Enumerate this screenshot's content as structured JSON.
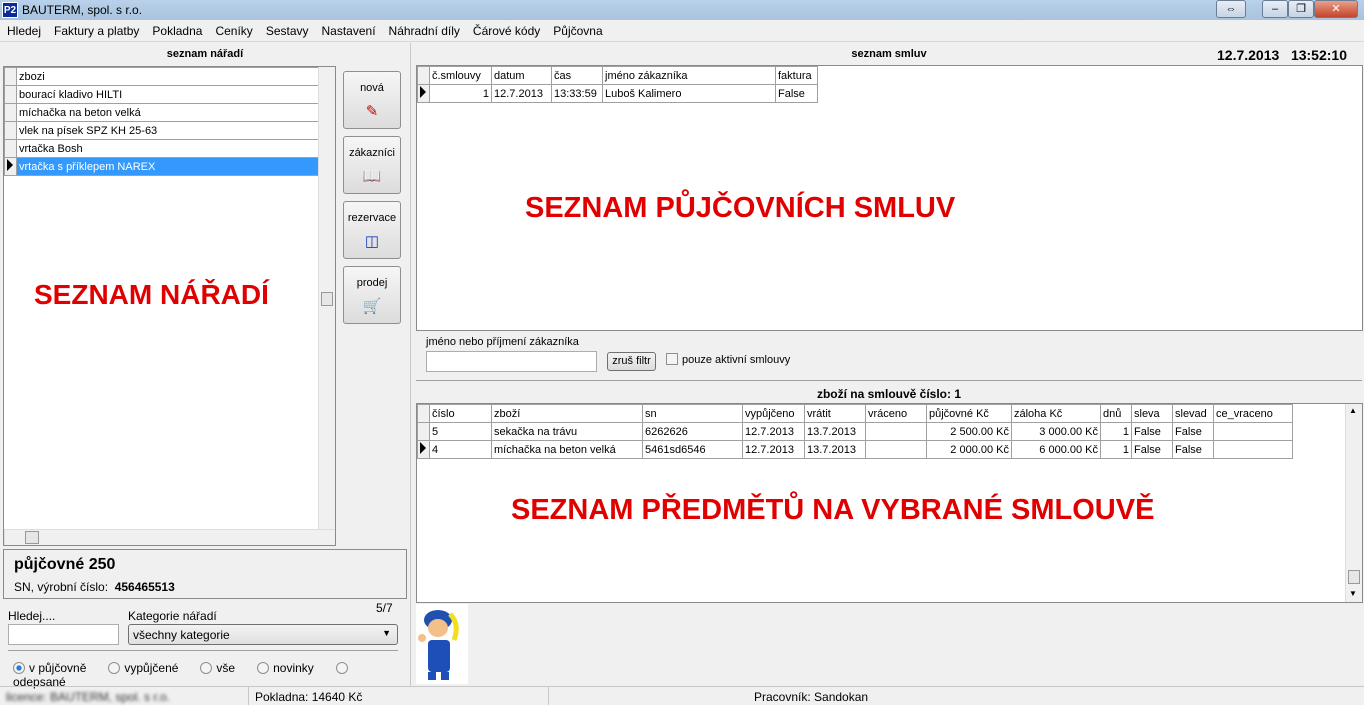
{
  "window": {
    "title": "BAUTERM, spol. s r.o.",
    "logo": "P2"
  },
  "menu": [
    "Hledej",
    "Faktury a platby",
    "Pokladna",
    "Ceníky",
    "Sestavy",
    "Nastavení",
    "Náhradní díly",
    "Čárové kódy",
    "Půjčovna"
  ],
  "left": {
    "title": "seznam nářadí",
    "column": "zbozi",
    "items": [
      "bourací kladivo HILTI",
      "míchačka na beton velká",
      "vlek na písek SPZ KH 25-63",
      "vrtačka Bosh",
      "vrtačka s příklepem NAREX"
    ],
    "overlay": "SEZNAM NÁŘADÍ",
    "rent_label": "půjčovné",
    "rent_value": "250",
    "sn_label": "SN, výrobní číslo:",
    "sn_value": "456465513",
    "counter": "5/7",
    "search_label": "Hledej....",
    "search_value": "",
    "category_label": "Kategorie nářadí",
    "category_value": "všechny kategorie",
    "filters": [
      "v půjčovně",
      "vypůjčené",
      "vše",
      "novinky",
      "odepsané"
    ]
  },
  "buttons": [
    {
      "label": "nová",
      "icon": "pen-icon"
    },
    {
      "label": "zákazníci",
      "icon": "address-book-icon"
    },
    {
      "label": "rezervace",
      "icon": "box-icon"
    },
    {
      "label": "prodej",
      "icon": "cart-icon"
    }
  ],
  "contracts": {
    "title": "seznam smluv",
    "datetime": "12.7.2013   13:52:10",
    "columns": [
      "č.smlouvy",
      "datum",
      "čas",
      "jméno zákazníka",
      "faktura"
    ],
    "rows": [
      [
        "1",
        "12.7.2013",
        "13:33:59",
        "Luboš Kalimero",
        "False"
      ]
    ],
    "overlay": "SEZNAM PŮJČOVNÍCH SMLUV",
    "filter_label": "jméno nebo příjmení zákazníka",
    "filter_value": "",
    "clear_button": "zruš filtr",
    "active_only": "pouze aktivní smlouvy"
  },
  "items": {
    "title": "zboží na smlouvě číslo: 1",
    "columns": [
      "číslo",
      "zboží",
      "sn",
      "vypůjčeno",
      "vrátit",
      "vráceno",
      "půjčovné Kč",
      "záloha Kč",
      "dnů",
      "sleva",
      "slevad",
      "ce_vraceno"
    ],
    "rows": [
      [
        "5",
        "sekačka na trávu",
        "6262626",
        "12.7.2013",
        "13.7.2013",
        "",
        "2 500.00 Kč",
        "3 000.00 Kč",
        "1",
        "False",
        "False",
        ""
      ],
      [
        "4",
        "míchačka na beton velká",
        "5461sd6546",
        "12.7.2013",
        "13.7.2013",
        "",
        "2 000.00 Kč",
        "6 000.00 Kč",
        "1",
        "False",
        "False",
        ""
      ]
    ],
    "overlay": "SEZNAM PŘEDMĚTŮ NA VYBRANÉ SMLOUVĚ"
  },
  "status": {
    "licence": "licence: BAUTERM, spol. s r.o.",
    "cash": "Pokladna:  14640 Kč",
    "worker": "Pracovník: Sandokan"
  }
}
